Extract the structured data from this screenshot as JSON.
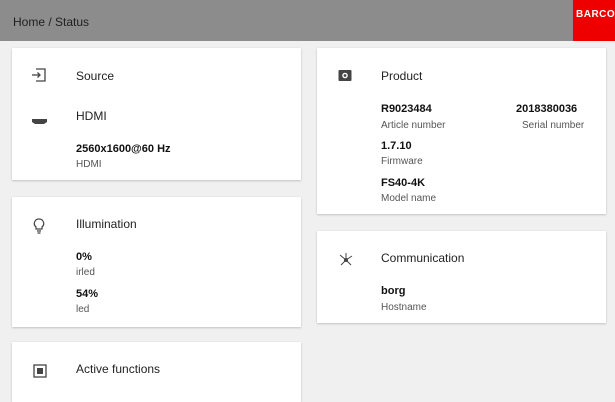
{
  "breadcrumb": "Home / Status",
  "brand": {
    "logo_text": "BARCO",
    "color": "#ee0000"
  },
  "source": {
    "title": "Source",
    "input": "HDMI",
    "resolution": "2560x1600@60 Hz",
    "resolution_sub": "HDMI"
  },
  "illumination": {
    "title": "Illumination",
    "items": [
      {
        "value": "0%",
        "label": "irled"
      },
      {
        "value": "54%",
        "label": "led"
      }
    ]
  },
  "active_functions": {
    "title": "Active functions"
  },
  "product": {
    "title": "Product",
    "article_number": "R9023484",
    "article_label": "Article number",
    "serial_number": "2018380036",
    "serial_label": "Serial number",
    "firmware": "1.7.10",
    "firmware_label": "Firmware",
    "model": "FS40-4K",
    "model_label": "Model name"
  },
  "communication": {
    "title": "Communication",
    "hostname": "borg",
    "hostname_label": "Hostname"
  },
  "icons": {
    "source": "input-icon",
    "hdmi": "hdmi-icon",
    "illumination": "lightbulb-icon",
    "product": "projector-icon",
    "communication": "network-icon",
    "active_functions": "functions-icon"
  }
}
